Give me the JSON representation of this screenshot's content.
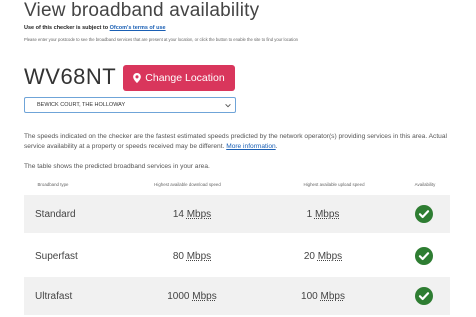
{
  "header": {
    "title": "View broadband availability",
    "terms_prefix": "Use of this checker is subject to",
    "terms_link": "Ofcom's terms of use",
    "instructions": "Please enter your postcode to see the broadband services that are present at your location, or click the button to enable the site to find your location"
  },
  "location": {
    "postcode": "WV68NT",
    "change_label": "Change Location",
    "address_selected": "BEWICK COURT, THE HOLLOWAY"
  },
  "info": {
    "speeds_text": "The speeds indicated on the checker are the fastest estimated speeds predicted by the network operator(s) providing services in this area. Actual service availability at a property or speeds received may be different.",
    "more_info_link": "More information",
    "table_intro": "The table shows the predicted broadband services in your area."
  },
  "table": {
    "headers": {
      "type": "Broadband type",
      "download": "Highest available download speed",
      "upload": "Highest available upload speed",
      "availability": "Availability"
    },
    "rows": [
      {
        "type": "Standard",
        "download": "14",
        "download_unit": "Mbps",
        "upload": "1",
        "upload_unit": "Mbps",
        "available": true
      },
      {
        "type": "Superfast",
        "download": "80",
        "download_unit": "Mbps",
        "upload": "20",
        "upload_unit": "Mbps",
        "available": true
      },
      {
        "type": "Ultrafast",
        "download": "1000",
        "download_unit": "Mbps",
        "upload": "100",
        "upload_unit": "Mbps",
        "available": true
      }
    ]
  },
  "colors": {
    "accent": "#d9365c",
    "available": "#2e7d32",
    "link": "#1a5fb4"
  },
  "icons": {
    "change_button": "map-pin-icon",
    "select": "chevron-down-icon",
    "availability": "check-circle-icon"
  }
}
